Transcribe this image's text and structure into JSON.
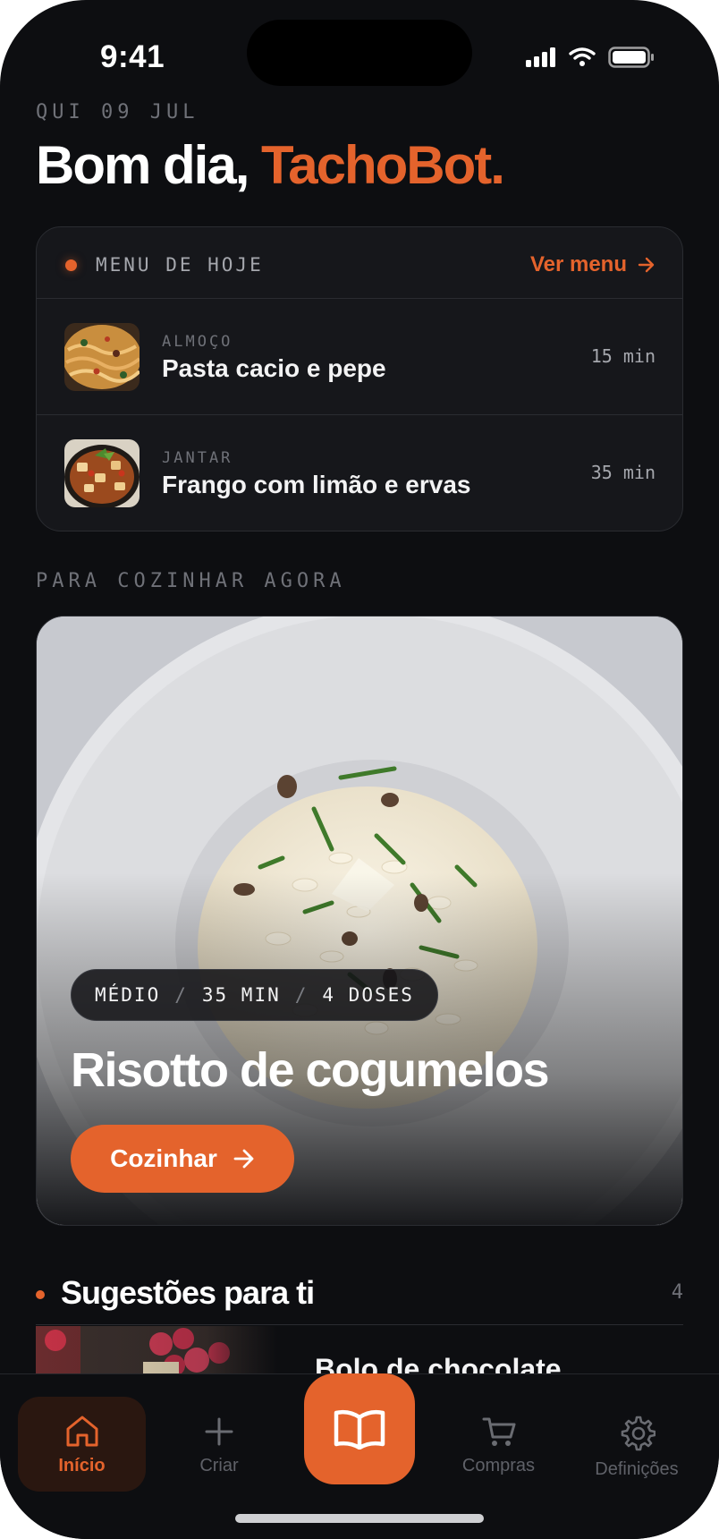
{
  "status_bar": {
    "time": "9:41"
  },
  "header": {
    "date": "QUI 09 JUL",
    "greeting_prefix": "Bom dia, ",
    "greeting_name": "TachoBot."
  },
  "menu": {
    "title": "MENU DE HOJE",
    "link": "Ver menu",
    "meals": [
      {
        "label": "ALMOÇO",
        "name": "Pasta cacio e pepe",
        "time": "15 min"
      },
      {
        "label": "JANTAR",
        "name": "Frango com limão e ervas",
        "time": "35 min"
      }
    ]
  },
  "cook_now": {
    "section_label": "PARA COZINHAR AGORA",
    "difficulty": "MÉDIO",
    "duration": "35 MIN",
    "servings": "4 DOSES",
    "separator": "/",
    "title": "Risotto de cogumelos",
    "button": "Cozinhar"
  },
  "suggestions": {
    "title": "Sugestões para ti",
    "count": "4",
    "first_item": "Bolo de chocolate"
  },
  "tabbar": {
    "home": "Início",
    "create": "Criar",
    "shopping": "Compras",
    "settings": "Definições"
  },
  "colors": {
    "accent": "#e4632c",
    "background": "#0d0e11",
    "card": "#16171b"
  }
}
